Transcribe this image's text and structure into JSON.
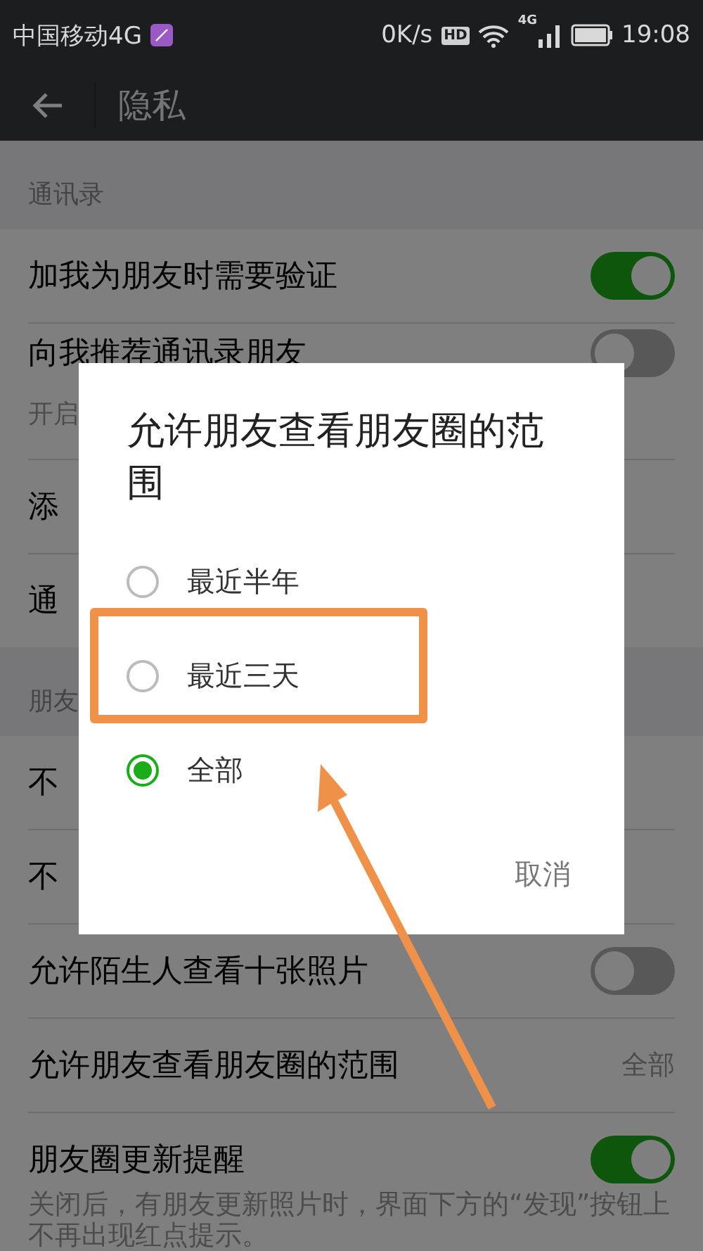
{
  "status_bar": {
    "carrier": "中国移动4G",
    "speed": "0K/s",
    "hd": "HD",
    "network": "4G",
    "time": "19:08"
  },
  "header": {
    "title": "隐私"
  },
  "sections": [
    {
      "header": "通讯录",
      "rows": [
        {
          "kind": "toggle",
          "label": "加我为朋友时需要验证",
          "on": true
        },
        {
          "kind": "toggle",
          "label": "向我推荐通讯录朋友",
          "sub": "开启",
          "on": false
        },
        {
          "kind": "plain",
          "label": "添"
        },
        {
          "kind": "plain",
          "label": "通"
        }
      ]
    },
    {
      "header": "朋友",
      "rows": [
        {
          "kind": "plain",
          "label": "不"
        },
        {
          "kind": "plain",
          "label": "不"
        },
        {
          "kind": "toggle",
          "label": "允许陌生人查看十张照片",
          "on": false
        },
        {
          "kind": "value",
          "label": "允许朋友查看朋友圈的范围",
          "value": "全部"
        },
        {
          "kind": "toggle",
          "label": "朋友圈更新提醒",
          "on": true,
          "sub": "关闭后，有朋友更新照片时，界面下方的“发现”按钮上不再出现红点提示。"
        }
      ]
    }
  ],
  "dialog": {
    "title": "允许朋友查看朋友圈的范围",
    "options": [
      {
        "label": "最近半年",
        "selected": false
      },
      {
        "label": "最近三天",
        "selected": false
      },
      {
        "label": "全部",
        "selected": true
      }
    ],
    "cancel": "取消"
  }
}
